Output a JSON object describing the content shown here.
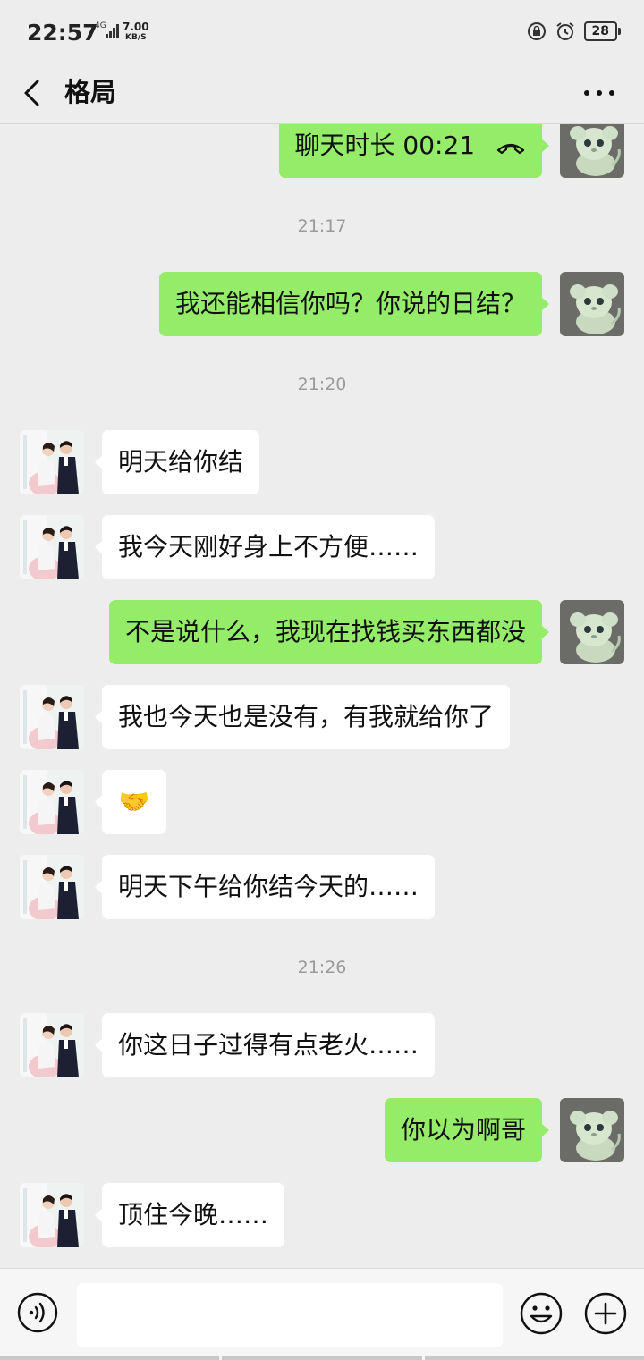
{
  "status_bar": {
    "time": "22:57",
    "network": "4G",
    "speed_value": "7.00",
    "speed_unit": "KB/S",
    "battery": "28"
  },
  "header": {
    "title": "格局",
    "back_icon": "chevron-left-icon",
    "more_icon": "ellipsis-icon"
  },
  "messages": [
    {
      "type": "call",
      "sender": "me",
      "text": "聊天时长 00:21"
    },
    {
      "type": "time",
      "text": "21:17"
    },
    {
      "type": "text",
      "sender": "me",
      "text": "我还能相信你吗？你说的日结？"
    },
    {
      "type": "time",
      "text": "21:20"
    },
    {
      "type": "text",
      "sender": "other",
      "text": "明天给你结"
    },
    {
      "type": "text",
      "sender": "other",
      "text": "我今天刚好身上不方便……"
    },
    {
      "type": "text",
      "sender": "me",
      "text": "不是说什么，我现在找钱买东西都没"
    },
    {
      "type": "text",
      "sender": "other",
      "text": "我也今天也是没有，有我就给你了"
    },
    {
      "type": "emoji",
      "sender": "other",
      "text": "🤝"
    },
    {
      "type": "text",
      "sender": "other",
      "text": "明天下午给你结今天的……"
    },
    {
      "type": "time",
      "text": "21:26"
    },
    {
      "type": "text",
      "sender": "other",
      "text": "你这日子过得有点老火……"
    },
    {
      "type": "text",
      "sender": "me",
      "text": "你以为啊哥"
    },
    {
      "type": "text",
      "sender": "other",
      "text": "顶住今晚……"
    }
  ],
  "input_bar": {
    "placeholder": "",
    "voice_icon": "voice-icon",
    "emoji_icon": "emoji-icon",
    "plus_icon": "plus-icon"
  },
  "colors": {
    "background": "#ededed",
    "my_bubble": "#95ec69",
    "other_bubble": "#ffffff",
    "timestamp": "#9a9a9a"
  }
}
